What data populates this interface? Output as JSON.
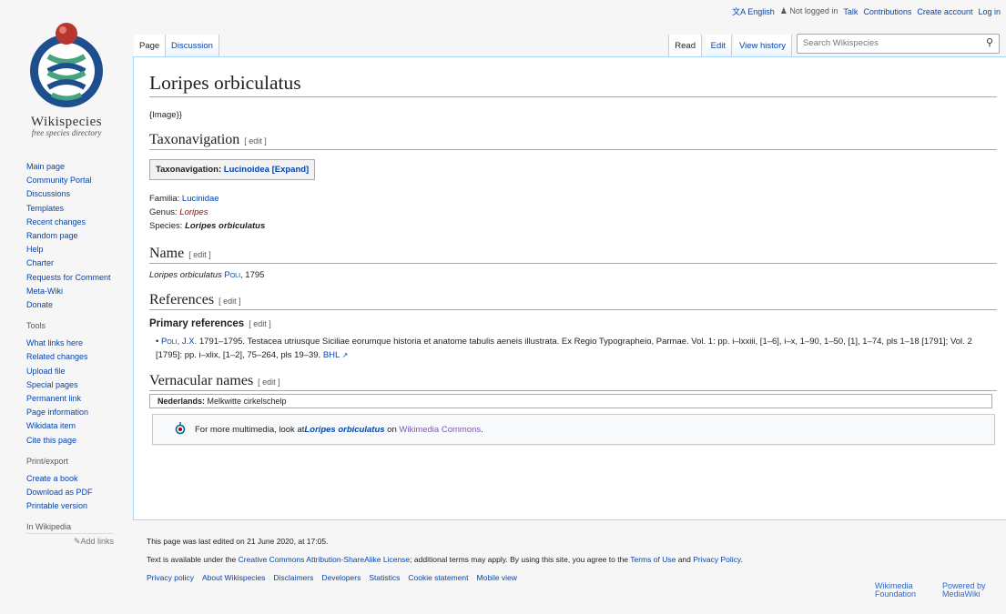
{
  "personal": {
    "language": "English",
    "not_logged_in": "Not logged in",
    "talk": "Talk",
    "contributions": "Contributions",
    "create_account": "Create account",
    "log_in": "Log in"
  },
  "logo": {
    "wordmark": "Wikispecies",
    "tagline": "free species directory"
  },
  "sidebar": {
    "navigation": [
      "Main page",
      "Community Portal",
      "Discussions",
      "Templates",
      "Recent changes",
      "Random page",
      "Help",
      "Charter",
      "Requests for Comment",
      "Meta-Wiki",
      "Donate"
    ],
    "tools_heading": "Tools",
    "tools": [
      "What links here",
      "Related changes",
      "Upload file",
      "Special pages",
      "Permanent link",
      "Page information",
      "Wikidata item",
      "Cite this page"
    ],
    "print_heading": "Print/export",
    "print": [
      "Create a book",
      "Download as PDF",
      "Printable version"
    ],
    "interwiki_heading": "In Wikipedia",
    "add_links": "Add links"
  },
  "tabs": {
    "page": "Page",
    "discussion": "Discussion",
    "read": "Read",
    "edit": "Edit",
    "history": "View history"
  },
  "search": {
    "placeholder": "Search Wikispecies"
  },
  "article": {
    "title": "Loripes orbiculatus",
    "image_placeholder": "{Image}}",
    "edit_label": "[ edit ]",
    "taxonav_heading": "Taxonavigation",
    "taxobox_prefix": "Taxonavigation:",
    "taxobox_link": "Lucinoidea",
    "taxobox_expand": "[Expand]",
    "familia_label": "Familia:",
    "familia_value": "Lucinidae",
    "genus_label": "Genus:",
    "genus_value": "Loripes",
    "species_label": "Species:",
    "species_value": "Loripes orbiculatus",
    "name_heading": "Name",
    "name_species": "Loripes orbiculatus",
    "name_author": "Poli",
    "name_year": ", 1795",
    "references_heading": "References",
    "primary_refs_heading": "Primary references",
    "ref_author": "Poli, J.X.",
    "ref_text": " 1791–1795. Testacea utriusque Siciliae eorumque historia et anatome tabulis aeneis illustrata. Ex Regio Typographeio, Parmae. Vol. 1: pp. i–lxxiii, [1–6], i–x, 1–90, 1–50, [1], 1–74, pls 1–18 [1791]; Vol. 2 [1795]: pp. i–xlix, [1–2], 75–264, pls 19–39. ",
    "ref_bhl": "BHL",
    "vernacular_heading": "Vernacular names",
    "vernacular_lang": "Nederlands:",
    "vernacular_name": "Melkwitte cirkelschelp",
    "commons_prefix": "For more multimedia, look at ",
    "commons_species": "Loripes orbiculatus",
    "commons_on": " on ",
    "commons_link": "Wikimedia Commons",
    "commons_end": "."
  },
  "footer": {
    "last_edited": "This page was last edited on 21 June 2020, at 17:05.",
    "license_prefix": "Text is available under the ",
    "license_link": "Creative Commons Attribution-ShareAlike License",
    "license_mid": "; additional terms may apply. By using this site, you agree to the ",
    "terms_link": "Terms of Use",
    "and": " and ",
    "privacy_link": "Privacy Policy",
    "end": ".",
    "places": [
      "Privacy policy",
      "About Wikispecies",
      "Disclaimers",
      "Developers",
      "Statistics",
      "Cookie statement",
      "Mobile view"
    ],
    "wikimedia_badge": "Wikimedia Foundation",
    "mediawiki_badge": "Powered by MediaWiki"
  },
  "colors": {
    "link": "#0645ad",
    "redlink": "#ba0000",
    "visited": "#0b0080",
    "border": "#a7d7f9"
  }
}
